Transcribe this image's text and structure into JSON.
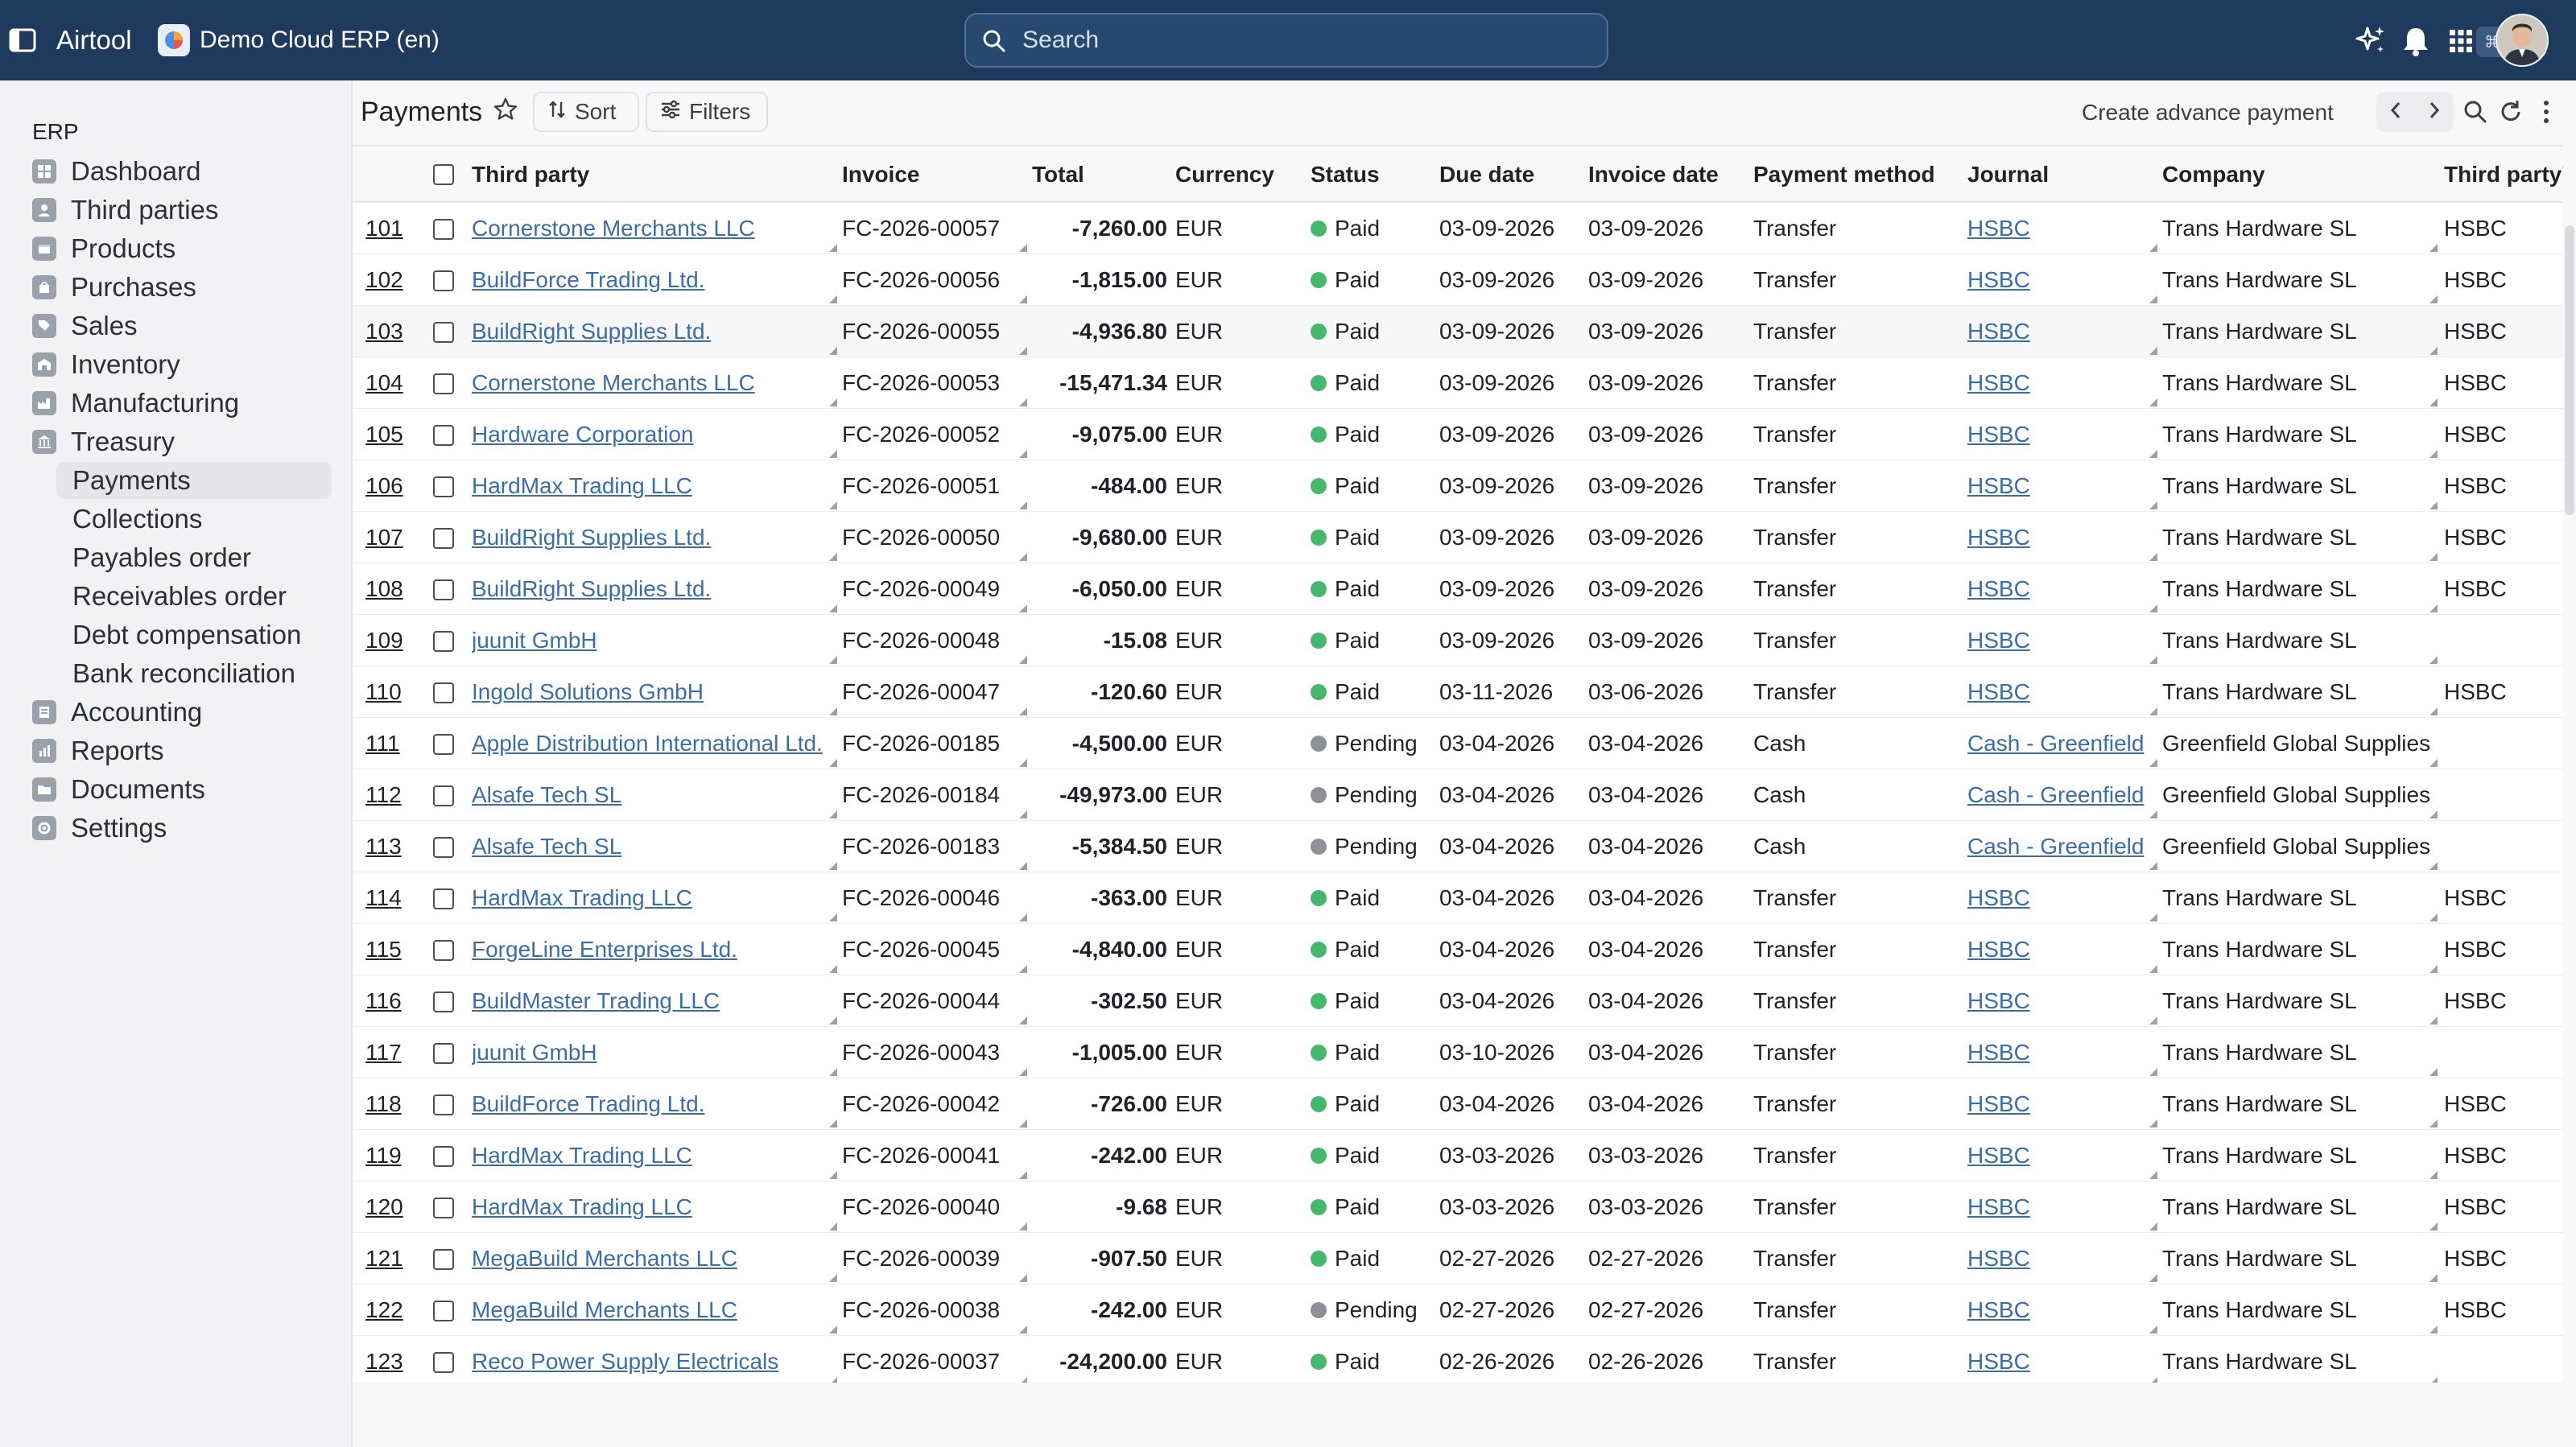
{
  "topbar": {
    "app_name": "Airtool",
    "environment": "Demo Cloud ERP (en)",
    "search_placeholder": "Search",
    "shortcut_keys": [
      "⌘",
      "K"
    ],
    "icons": [
      "sidebar-toggle-icon",
      "sparkles-icon",
      "bell-icon",
      "apps-grid-icon"
    ]
  },
  "sidebar": {
    "section": "ERP",
    "items": [
      {
        "label": "Dashboard",
        "icon": "dashboard-icon"
      },
      {
        "label": "Third parties",
        "icon": "person-icon"
      },
      {
        "label": "Products",
        "icon": "box-icon"
      },
      {
        "label": "Purchases",
        "icon": "bag-icon"
      },
      {
        "label": "Sales",
        "icon": "tag-icon"
      },
      {
        "label": "Inventory",
        "icon": "warehouse-icon"
      },
      {
        "label": "Manufacturing",
        "icon": "factory-icon"
      },
      {
        "label": "Treasury",
        "icon": "bank-icon"
      }
    ],
    "treasury_subitems": [
      {
        "label": "Payments",
        "active": true
      },
      {
        "label": "Collections",
        "active": false
      },
      {
        "label": "Payables order",
        "active": false
      },
      {
        "label": "Receivables order",
        "active": false
      },
      {
        "label": "Debt compensation",
        "active": false
      },
      {
        "label": "Bank reconciliation",
        "active": false
      }
    ],
    "items_after": [
      {
        "label": "Accounting",
        "icon": "ledger-icon"
      },
      {
        "label": "Reports",
        "icon": "report-icon"
      },
      {
        "label": "Documents",
        "icon": "folder-icon"
      },
      {
        "label": "Settings",
        "icon": "gear-icon"
      }
    ]
  },
  "toolbar": {
    "title": "Payments",
    "sort_label": "Sort",
    "filters_label": "Filters",
    "create_label": "Create advance payment"
  },
  "table": {
    "columns": [
      "Third party",
      "Invoice",
      "Total",
      "Currency",
      "Status",
      "Due date",
      "Invoice date",
      "Payment method",
      "Journal",
      "Company",
      "Third party's"
    ],
    "status_colors": {
      "Paid": "#45b86b",
      "Pending": "#8d9197"
    },
    "rows": [
      {
        "id": "101",
        "third_party": "Cornerstone Merchants LLC",
        "invoice": "FC-2026-00057",
        "total": "-7,260.00",
        "currency": "EUR",
        "status": "Paid",
        "due_date": "03-09-2026",
        "invoice_date": "03-09-2026",
        "payment_method": "Transfer",
        "journal": "HSBC",
        "company": "Trans Hardware SL",
        "third_party_bank": "HSBC"
      },
      {
        "id": "102",
        "third_party": "BuildForce Trading Ltd.",
        "invoice": "FC-2026-00056",
        "total": "-1,815.00",
        "currency": "EUR",
        "status": "Paid",
        "due_date": "03-09-2026",
        "invoice_date": "03-09-2026",
        "payment_method": "Transfer",
        "journal": "HSBC",
        "company": "Trans Hardware SL",
        "third_party_bank": "HSBC"
      },
      {
        "id": "103",
        "third_party": "BuildRight Supplies Ltd.",
        "invoice": "FC-2026-00055",
        "total": "-4,936.80",
        "currency": "EUR",
        "status": "Paid",
        "due_date": "03-09-2026",
        "invoice_date": "03-09-2026",
        "payment_method": "Transfer",
        "journal": "HSBC",
        "company": "Trans Hardware SL",
        "third_party_bank": "HSBC"
      },
      {
        "id": "104",
        "third_party": "Cornerstone Merchants LLC",
        "invoice": "FC-2026-00053",
        "total": "-15,471.34",
        "currency": "EUR",
        "status": "Paid",
        "due_date": "03-09-2026",
        "invoice_date": "03-09-2026",
        "payment_method": "Transfer",
        "journal": "HSBC",
        "company": "Trans Hardware SL",
        "third_party_bank": "HSBC"
      },
      {
        "id": "105",
        "third_party": "Hardware Corporation",
        "invoice": "FC-2026-00052",
        "total": "-9,075.00",
        "currency": "EUR",
        "status": "Paid",
        "due_date": "03-09-2026",
        "invoice_date": "03-09-2026",
        "payment_method": "Transfer",
        "journal": "HSBC",
        "company": "Trans Hardware SL",
        "third_party_bank": "HSBC"
      },
      {
        "id": "106",
        "third_party": "HardMax Trading LLC",
        "invoice": "FC-2026-00051",
        "total": "-484.00",
        "currency": "EUR",
        "status": "Paid",
        "due_date": "03-09-2026",
        "invoice_date": "03-09-2026",
        "payment_method": "Transfer",
        "journal": "HSBC",
        "company": "Trans Hardware SL",
        "third_party_bank": "HSBC"
      },
      {
        "id": "107",
        "third_party": "BuildRight Supplies Ltd.",
        "invoice": "FC-2026-00050",
        "total": "-9,680.00",
        "currency": "EUR",
        "status": "Paid",
        "due_date": "03-09-2026",
        "invoice_date": "03-09-2026",
        "payment_method": "Transfer",
        "journal": "HSBC",
        "company": "Trans Hardware SL",
        "third_party_bank": "HSBC"
      },
      {
        "id": "108",
        "third_party": "BuildRight Supplies Ltd.",
        "invoice": "FC-2026-00049",
        "total": "-6,050.00",
        "currency": "EUR",
        "status": "Paid",
        "due_date": "03-09-2026",
        "invoice_date": "03-09-2026",
        "payment_method": "Transfer",
        "journal": "HSBC",
        "company": "Trans Hardware SL",
        "third_party_bank": "HSBC"
      },
      {
        "id": "109",
        "third_party": "juunit GmbH",
        "invoice": "FC-2026-00048",
        "total": "-15.08",
        "currency": "EUR",
        "status": "Paid",
        "due_date": "03-09-2026",
        "invoice_date": "03-09-2026",
        "payment_method": "Transfer",
        "journal": "HSBC",
        "company": "Trans Hardware SL",
        "third_party_bank": ""
      },
      {
        "id": "110",
        "third_party": "Ingold Solutions GmbH",
        "invoice": "FC-2026-00047",
        "total": "-120.60",
        "currency": "EUR",
        "status": "Paid",
        "due_date": "03-11-2026",
        "invoice_date": "03-06-2026",
        "payment_method": "Transfer",
        "journal": "HSBC",
        "company": "Trans Hardware SL",
        "third_party_bank": "HSBC"
      },
      {
        "id": "111",
        "third_party": "Apple Distribution International Ltd.",
        "invoice": "FC-2026-00185",
        "total": "-4,500.00",
        "currency": "EUR",
        "status": "Pending",
        "due_date": "03-04-2026",
        "invoice_date": "03-04-2026",
        "payment_method": "Cash",
        "journal": "Cash - Greenfield",
        "company": "Greenfield Global Supplies",
        "third_party_bank": ""
      },
      {
        "id": "112",
        "third_party": "Alsafe Tech SL",
        "invoice": "FC-2026-00184",
        "total": "-49,973.00",
        "currency": "EUR",
        "status": "Pending",
        "due_date": "03-04-2026",
        "invoice_date": "03-04-2026",
        "payment_method": "Cash",
        "journal": "Cash - Greenfield",
        "company": "Greenfield Global Supplies",
        "third_party_bank": ""
      },
      {
        "id": "113",
        "third_party": "Alsafe Tech SL",
        "invoice": "FC-2026-00183",
        "total": "-5,384.50",
        "currency": "EUR",
        "status": "Pending",
        "due_date": "03-04-2026",
        "invoice_date": "03-04-2026",
        "payment_method": "Cash",
        "journal": "Cash - Greenfield",
        "company": "Greenfield Global Supplies",
        "third_party_bank": ""
      },
      {
        "id": "114",
        "third_party": "HardMax Trading LLC",
        "invoice": "FC-2026-00046",
        "total": "-363.00",
        "currency": "EUR",
        "status": "Paid",
        "due_date": "03-04-2026",
        "invoice_date": "03-04-2026",
        "payment_method": "Transfer",
        "journal": "HSBC",
        "company": "Trans Hardware SL",
        "third_party_bank": "HSBC"
      },
      {
        "id": "115",
        "third_party": "ForgeLine Enterprises Ltd.",
        "invoice": "FC-2026-00045",
        "total": "-4,840.00",
        "currency": "EUR",
        "status": "Paid",
        "due_date": "03-04-2026",
        "invoice_date": "03-04-2026",
        "payment_method": "Transfer",
        "journal": "HSBC",
        "company": "Trans Hardware SL",
        "third_party_bank": "HSBC"
      },
      {
        "id": "116",
        "third_party": "BuildMaster Trading LLC",
        "invoice": "FC-2026-00044",
        "total": "-302.50",
        "currency": "EUR",
        "status": "Paid",
        "due_date": "03-04-2026",
        "invoice_date": "03-04-2026",
        "payment_method": "Transfer",
        "journal": "HSBC",
        "company": "Trans Hardware SL",
        "third_party_bank": "HSBC"
      },
      {
        "id": "117",
        "third_party": "juunit GmbH",
        "invoice": "FC-2026-00043",
        "total": "-1,005.00",
        "currency": "EUR",
        "status": "Paid",
        "due_date": "03-10-2026",
        "invoice_date": "03-04-2026",
        "payment_method": "Transfer",
        "journal": "HSBC",
        "company": "Trans Hardware SL",
        "third_party_bank": ""
      },
      {
        "id": "118",
        "third_party": "BuildForce Trading Ltd.",
        "invoice": "FC-2026-00042",
        "total": "-726.00",
        "currency": "EUR",
        "status": "Paid",
        "due_date": "03-04-2026",
        "invoice_date": "03-04-2026",
        "payment_method": "Transfer",
        "journal": "HSBC",
        "company": "Trans Hardware SL",
        "third_party_bank": "HSBC"
      },
      {
        "id": "119",
        "third_party": "HardMax Trading LLC",
        "invoice": "FC-2026-00041",
        "total": "-242.00",
        "currency": "EUR",
        "status": "Paid",
        "due_date": "03-03-2026",
        "invoice_date": "03-03-2026",
        "payment_method": "Transfer",
        "journal": "HSBC",
        "company": "Trans Hardware SL",
        "third_party_bank": "HSBC"
      },
      {
        "id": "120",
        "third_party": "HardMax Trading LLC",
        "invoice": "FC-2026-00040",
        "total": "-9.68",
        "currency": "EUR",
        "status": "Paid",
        "due_date": "03-03-2026",
        "invoice_date": "03-03-2026",
        "payment_method": "Transfer",
        "journal": "HSBC",
        "company": "Trans Hardware SL",
        "third_party_bank": "HSBC"
      },
      {
        "id": "121",
        "third_party": "MegaBuild Merchants LLC",
        "invoice": "FC-2026-00039",
        "total": "-907.50",
        "currency": "EUR",
        "status": "Paid",
        "due_date": "02-27-2026",
        "invoice_date": "02-27-2026",
        "payment_method": "Transfer",
        "journal": "HSBC",
        "company": "Trans Hardware SL",
        "third_party_bank": "HSBC"
      },
      {
        "id": "122",
        "third_party": "MegaBuild Merchants LLC",
        "invoice": "FC-2026-00038",
        "total": "-242.00",
        "currency": "EUR",
        "status": "Pending",
        "due_date": "02-27-2026",
        "invoice_date": "02-27-2026",
        "payment_method": "Transfer",
        "journal": "HSBC",
        "company": "Trans Hardware SL",
        "third_party_bank": "HSBC"
      },
      {
        "id": "123",
        "third_party": "Reco Power Supply Electricals",
        "invoice": "FC-2026-00037",
        "total": "-24,200.00",
        "currency": "EUR",
        "status": "Paid",
        "due_date": "02-26-2026",
        "invoice_date": "02-26-2026",
        "payment_method": "Transfer",
        "journal": "HSBC",
        "company": "Trans Hardware SL",
        "third_party_bank": ""
      }
    ]
  }
}
